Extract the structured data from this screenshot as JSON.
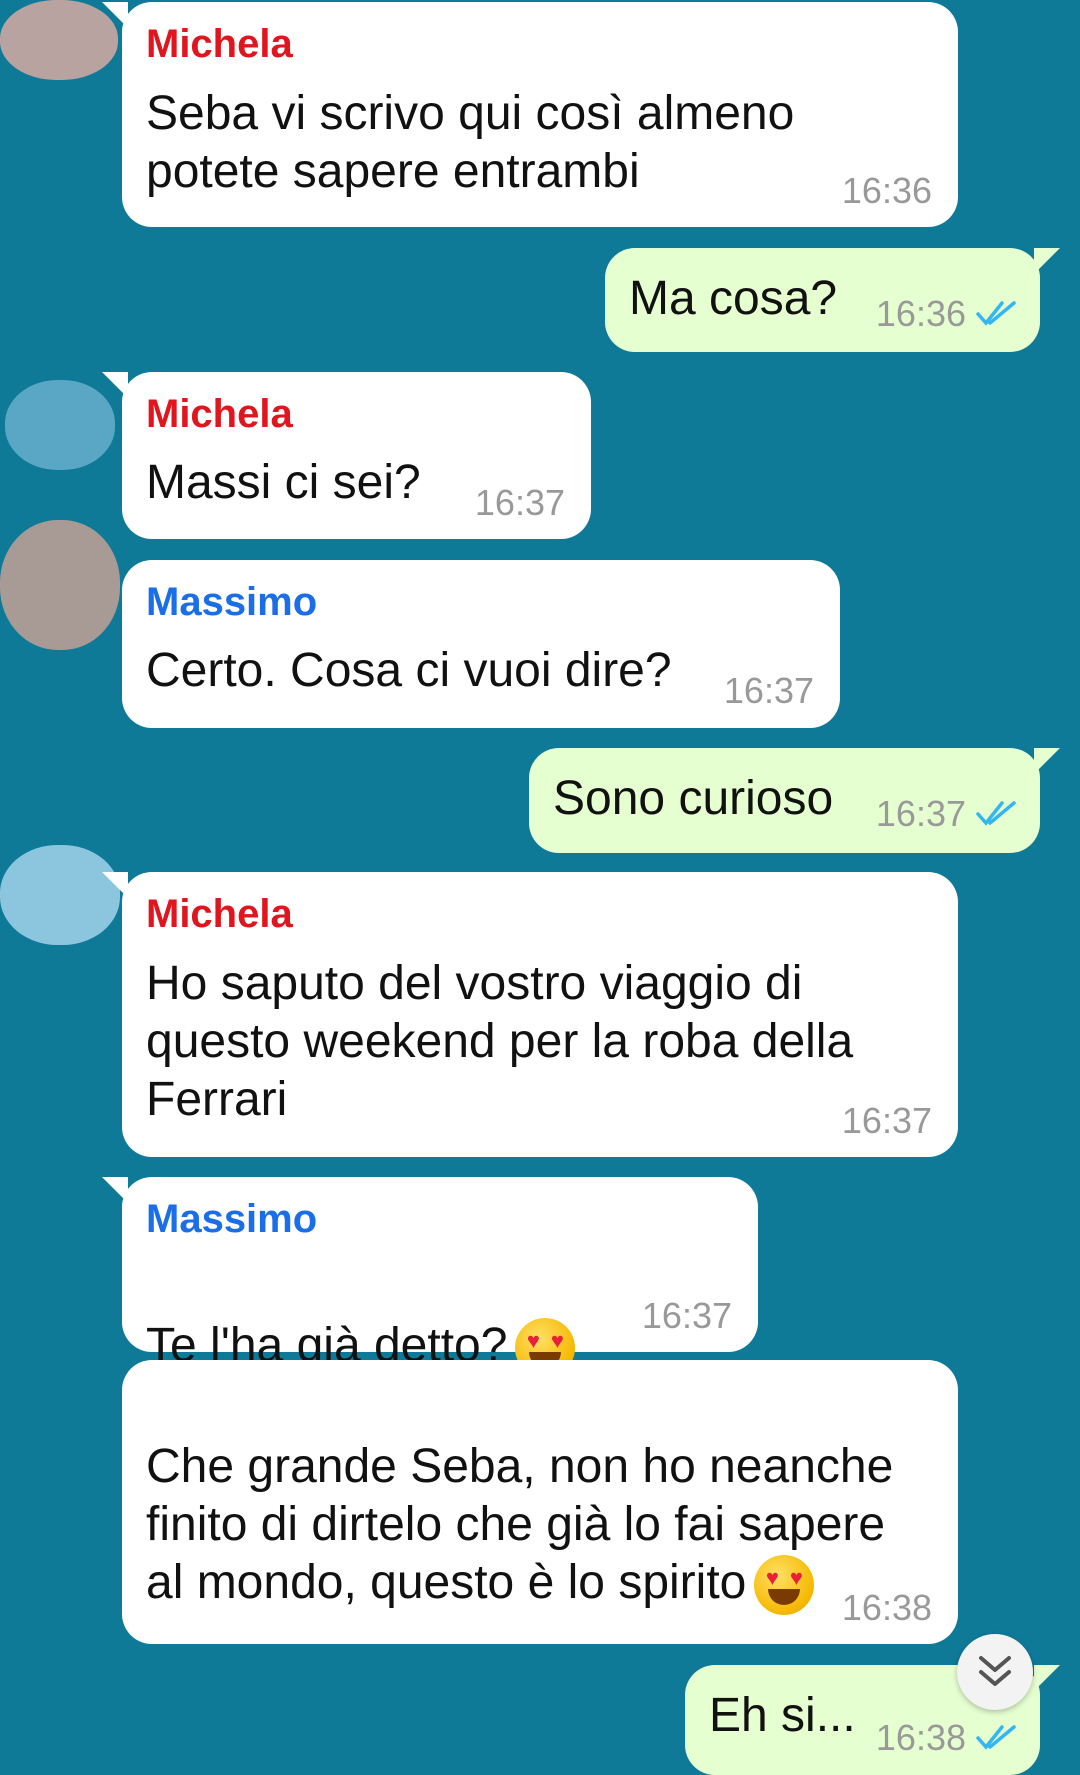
{
  "messages": [
    {
      "sender": "Michela",
      "text": "Seba vi scrivo qui così almeno\npotete sapere entrambi",
      "time": "16:36"
    },
    {
      "text": "Ma cosa?",
      "time": "16:36"
    },
    {
      "sender": "Michela",
      "text": "Massi ci sei?",
      "time": "16:37"
    },
    {
      "sender": "Massimo",
      "text": "Certo. Cosa ci vuoi dire?",
      "time": "16:37"
    },
    {
      "text": "Sono curioso",
      "time": "16:37"
    },
    {
      "sender": "Michela",
      "text": "Ho saputo del vostro viaggio di\nquesto weekend per la roba della\nFerrari",
      "time": "16:37"
    },
    {
      "sender": "Massimo",
      "text": "Te l'ha già detto?",
      "emoji": "heart-eyes-emoji",
      "time": "16:37"
    },
    {
      "text": "Che grande Seba, non ho neanche\nfinito di dirtelo che già lo fai sapere\nal mondo, questo è lo spirito",
      "emoji": "heart-eyes-emoji",
      "time": "16:38"
    },
    {
      "text": "Eh si...",
      "time": "16:38"
    }
  ],
  "colors": {
    "background": "#0f7a98",
    "incoming_bubble": "#ffffff",
    "outgoing_bubble": "#e6ffd1",
    "sender_michela": "#e0151d",
    "sender_massimo": "#1a6ee8",
    "read_ticks": "#34b7f1"
  },
  "icons": {
    "read_receipt": "double-check-icon",
    "scroll_down": "chevrons-down-icon"
  }
}
